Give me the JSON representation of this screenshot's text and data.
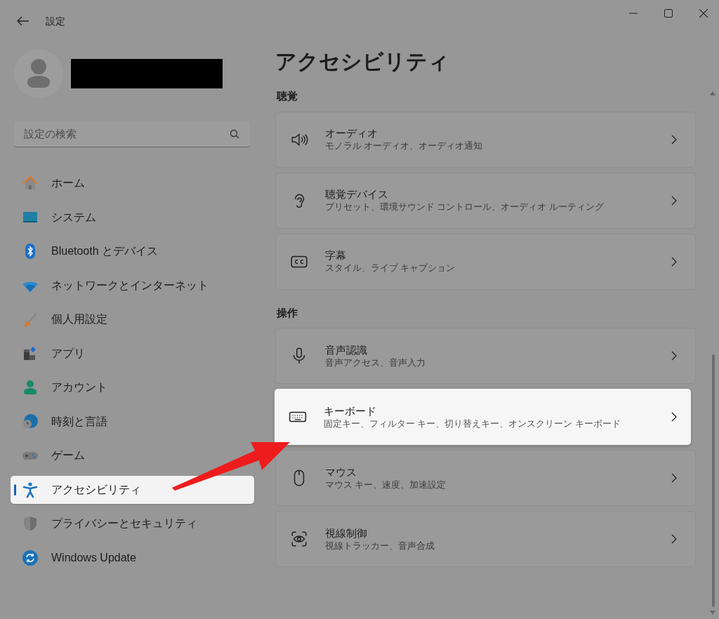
{
  "window": {
    "title": "設定"
  },
  "search": {
    "placeholder": "設定の検索"
  },
  "nav": [
    {
      "label": "ホーム",
      "kind": "home",
      "selected": false
    },
    {
      "label": "システム",
      "kind": "system",
      "selected": false
    },
    {
      "label": "Bluetooth とデバイス",
      "kind": "bluetooth",
      "selected": false
    },
    {
      "label": "ネットワークとインターネット",
      "kind": "wifi",
      "selected": false
    },
    {
      "label": "個人用設定",
      "kind": "brush",
      "selected": false
    },
    {
      "label": "アプリ",
      "kind": "apps",
      "selected": false
    },
    {
      "label": "アカウント",
      "kind": "account",
      "selected": false
    },
    {
      "label": "時刻と言語",
      "kind": "time",
      "selected": false
    },
    {
      "label": "ゲーム",
      "kind": "game",
      "selected": false
    },
    {
      "label": "アクセシビリティ",
      "kind": "accessibility",
      "selected": true
    },
    {
      "label": "プライバシーとセキュリティ",
      "kind": "shield",
      "selected": false
    },
    {
      "label": "Windows Update",
      "kind": "update",
      "selected": false
    }
  ],
  "page": {
    "title": "アクセシビリティ",
    "sections": [
      {
        "heading": "聴覚",
        "items": [
          {
            "title": "オーディオ",
            "subtitle": "モノラル オーディオ、オーディオ通知",
            "kind": "speaker",
            "highlighted": false
          },
          {
            "title": "聴覚デバイス",
            "subtitle": "プリセット、環境サウンド コントロール、オーディオ ルーティング",
            "kind": "ear",
            "highlighted": false
          },
          {
            "title": "字幕",
            "subtitle": "スタイル、ライブ キャプション",
            "kind": "cc",
            "highlighted": false
          }
        ]
      },
      {
        "heading": "操作",
        "items": [
          {
            "title": "音声認識",
            "subtitle": "音声アクセス、音声入力",
            "kind": "mic",
            "highlighted": false
          },
          {
            "title": "キーボード",
            "subtitle": "固定キー、フィルター キー、切り替えキー、オンスクリーン キーボード",
            "kind": "keyboard",
            "highlighted": true
          },
          {
            "title": "マウス",
            "subtitle": "マウス キー、速度、加速設定",
            "kind": "mouse",
            "highlighted": false
          },
          {
            "title": "視線制御",
            "subtitle": "視線トラッカー、音声合成",
            "kind": "eye",
            "highlighted": false
          }
        ]
      }
    ]
  }
}
